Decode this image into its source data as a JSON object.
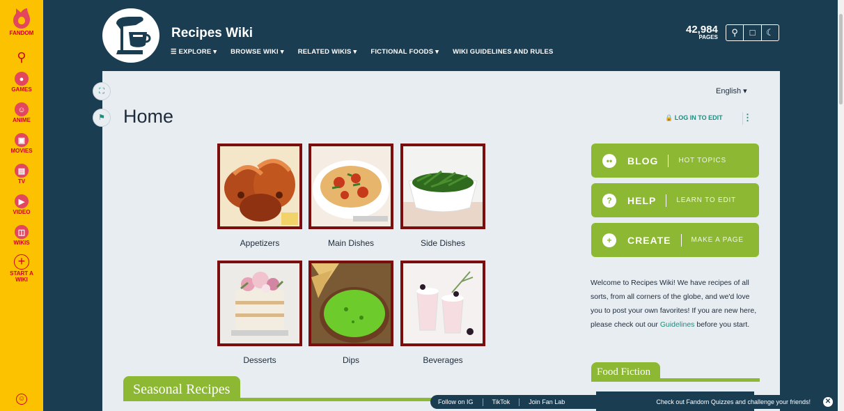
{
  "rail": {
    "brand_label": "FANDOM",
    "items": [
      {
        "label": "GAMES",
        "icon": "gamepad-icon"
      },
      {
        "label": "ANIME",
        "icon": "anime-icon"
      },
      {
        "label": "MOVIES",
        "icon": "movie-icon"
      },
      {
        "label": "TV",
        "icon": "tv-icon"
      },
      {
        "label": "VIDEO",
        "icon": "video-icon"
      },
      {
        "label": "WIKIS",
        "icon": "book-icon"
      },
      {
        "label": "START A WIKI",
        "icon": "plus-circle-icon"
      }
    ]
  },
  "header": {
    "wiki_title": "Recipes Wiki",
    "nav": [
      "EXPLORE ▾",
      "BROWSE WIKI ▾",
      "RELATED WIKIS ▾",
      "FICTIONAL FOODS ▾",
      "WIKI GUIDELINES AND RULES"
    ],
    "pages_count": "42,984",
    "pages_label": "PAGES"
  },
  "page": {
    "language": "English ▾",
    "title": "Home",
    "login_label": "LOG IN TO EDIT"
  },
  "foods": [
    {
      "label": "Appetizers"
    },
    {
      "label": "Main Dishes"
    },
    {
      "label": "Side Dishes"
    },
    {
      "label": "Desserts"
    },
    {
      "label": "Dips"
    },
    {
      "label": "Beverages"
    }
  ],
  "actions": [
    {
      "main": "BLOG",
      "sub": "HOT TOPICS"
    },
    {
      "main": "HELP",
      "sub": "LEARN TO EDIT"
    },
    {
      "main": "CREATE",
      "sub": "MAKE A PAGE"
    }
  ],
  "welcome": {
    "text_before": "Welcome to Recipes Wiki! We have recipes of all sorts, from all corners of the globe, and we'd love you to post your own favorites! If you are new here, please check out our ",
    "link": "Guidelines",
    "text_after": " before you start."
  },
  "sections": {
    "seasonal": "Seasonal Recipes",
    "food_fiction": "Food Fiction"
  },
  "bottom_bar": {
    "links": [
      "Follow on IG",
      "TikTok",
      "Join Fan Lab"
    ],
    "promo": "Check out Fandom Quizzes and challenge your friends!"
  },
  "colors": {
    "rail": "#fcc200",
    "header_bg": "#1b3d52",
    "accent_green": "#8cb833",
    "tile_border": "#7a0d0d",
    "link": "#1e8b7d"
  }
}
